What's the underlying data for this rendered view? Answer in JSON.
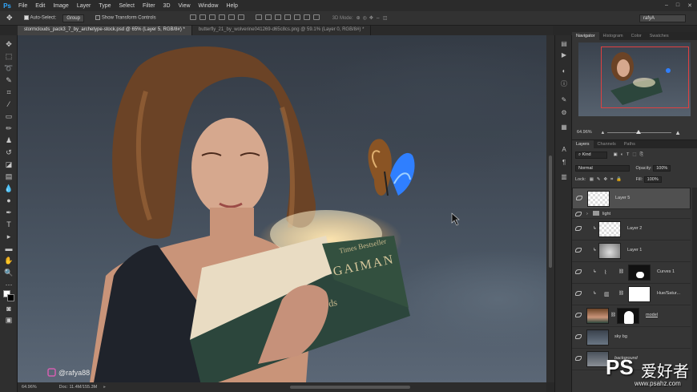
{
  "app": {
    "logo": "Ps"
  },
  "menu": [
    "File",
    "Edit",
    "Image",
    "Layer",
    "Type",
    "Select",
    "Filter",
    "3D",
    "View",
    "Window",
    "Help"
  ],
  "window_controls": [
    "–",
    "□",
    "✕"
  ],
  "options": {
    "auto_select_label": "Auto-Select:",
    "auto_select_value": "Group",
    "transform_label": "Show Transform Controls",
    "mode_3d": "3D Mode:",
    "workspace": "rafyA"
  },
  "tabs": [
    {
      "label": "stormclouds_pack3_7_by_archetype-stock.psd @ 65% (Layer 5, RGB/8#) *",
      "active": true
    },
    {
      "label": "butterfly_21_by_wolverine041269-d65c8cs.png @ 59.1% (Layer 0, RGB/8#) *",
      "active": false
    }
  ],
  "status": {
    "zoom": "64.96%",
    "doc": "Doc: 11.4M/155.3M"
  },
  "watermark_handle": "@rafya88",
  "book_text": {
    "line1": "Times Bestseller",
    "line2": "GAIMAN",
    "line3": "ky Gods"
  },
  "navigator": {
    "tabs": [
      "Navigator",
      "Histogram",
      "Color",
      "Swatches"
    ],
    "zoom": "64.96%"
  },
  "layers_panel": {
    "tabs": [
      "Layers",
      "Channels",
      "Paths"
    ],
    "kind": "Kind",
    "blend": "Normal",
    "opacity_label": "Opacity:",
    "opacity": "100%",
    "lock_label": "Lock:",
    "fill_label": "Fill:",
    "fill": "100%",
    "layers": [
      {
        "name": "Layer 5",
        "selected": true
      },
      {
        "name": "light",
        "group": true
      },
      {
        "name": "Layer 2"
      },
      {
        "name": "Layer 1"
      },
      {
        "name": "Curves 1"
      },
      {
        "name": "Hue/Satur..."
      },
      {
        "name": "model"
      },
      {
        "name": "sky bg"
      },
      {
        "name": "background"
      }
    ]
  },
  "site_watermark": {
    "brand": "PS",
    "chinese": "爱好者",
    "url": "www.psahz.com"
  },
  "colors": {
    "accent": "#31a8ff",
    "nav_frame": "#e04040",
    "butterfly_blue": "#2f7fff"
  }
}
